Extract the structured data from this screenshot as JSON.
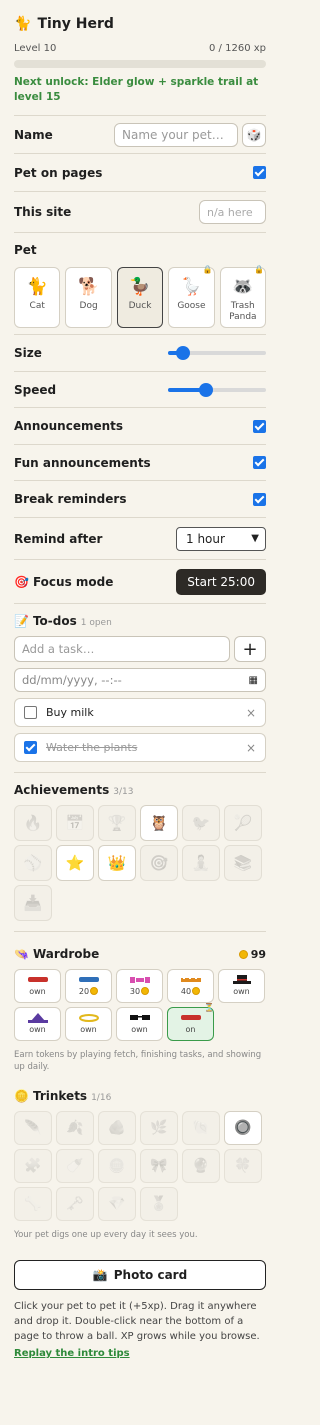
{
  "header": {
    "title_icon": "cat-icon",
    "title": "Tiny Herd",
    "level": "Level 10",
    "xp": "0 / 1260 xp",
    "xp_progress": 0.0,
    "unlock": "Next unlock: Elder glow + sparkle trail at level 15"
  },
  "name": {
    "label": "Name",
    "placeholder": "Name your pet…",
    "dice_icon": "dice-icon"
  },
  "pet_on_pages": {
    "label": "Pet on pages",
    "checked": true
  },
  "this_site": {
    "label": "This site",
    "placeholder": "n/a here"
  },
  "pet": {
    "label": "Pet",
    "options": [
      {
        "name": "Cat",
        "icon": "🐈",
        "selected": false,
        "locked": false
      },
      {
        "name": "Dog",
        "icon": "🐕",
        "selected": false,
        "locked": false
      },
      {
        "name": "Duck",
        "icon": "🦆",
        "selected": true,
        "locked": false
      },
      {
        "name": "Goose",
        "icon": "🪿",
        "selected": false,
        "locked": true
      },
      {
        "name": "Trash Panda",
        "icon": "🦝",
        "selected": false,
        "locked": true
      }
    ],
    "lock_icon": "🔒"
  },
  "size": {
    "label": "Size",
    "value": 0.1
  },
  "speed": {
    "label": "Speed",
    "value": 0.37
  },
  "announcements": {
    "label": "Announcements",
    "checked": true
  },
  "fun_announcements": {
    "label": "Fun announcements",
    "checked": true
  },
  "break_reminders": {
    "label": "Break reminders",
    "checked": true
  },
  "remind_after": {
    "label": "Remind after",
    "value": "1 hour"
  },
  "focus": {
    "icon": "🎯",
    "label": "Focus mode",
    "button": "Start 25:00"
  },
  "todos": {
    "icon": "📝",
    "label": "To-dos",
    "count": "1 open",
    "placeholder": "Add a task…",
    "add": "+",
    "date_placeholder": "dd/mm/yyyy, --:--",
    "items": [
      {
        "text": "Buy milk",
        "done": false
      },
      {
        "text": "Water the plants",
        "done": true
      }
    ],
    "remove": "×"
  },
  "achievements": {
    "label": "Achievements",
    "count": "3/13",
    "items": [
      {
        "icon": "🔥",
        "on": false
      },
      {
        "icon": "📅",
        "on": false
      },
      {
        "icon": "🏆",
        "on": false
      },
      {
        "icon": "🦉",
        "on": true
      },
      {
        "icon": "🐦",
        "on": false
      },
      {
        "icon": "🎾",
        "on": false
      },
      {
        "icon": "⚾",
        "on": false
      },
      {
        "icon": "⭐",
        "on": true
      },
      {
        "icon": "👑",
        "on": true
      },
      {
        "icon": "🎯",
        "on": false
      },
      {
        "icon": "🧘",
        "on": false
      },
      {
        "icon": "📚",
        "on": false
      },
      {
        "icon": "📥",
        "on": false
      }
    ]
  },
  "wardrobe": {
    "icon": "👒",
    "label": "Wardrobe",
    "coins": "99",
    "items": [
      {
        "label": "own",
        "price": "",
        "color": "#c8312b",
        "shape": "cap",
        "on": false
      },
      {
        "label": "",
        "price": "20",
        "color": "#2f6fb8",
        "shape": "cap",
        "on": false
      },
      {
        "label": "",
        "price": "30",
        "color": "#d84fb0",
        "shape": "bow",
        "on": false
      },
      {
        "label": "",
        "price": "40",
        "color": "#e08a1e",
        "shape": "band",
        "on": false
      },
      {
        "label": "own",
        "price": "",
        "color": "#1a1a1a",
        "shape": "tophat",
        "on": false
      },
      {
        "label": "own",
        "price": "",
        "color": "#5a3aa0",
        "shape": "wizard",
        "on": false
      },
      {
        "label": "own",
        "price": "",
        "color": "#e2b81c",
        "shape": "halo",
        "on": false
      },
      {
        "label": "own",
        "price": "",
        "color": "#111111",
        "shape": "shades",
        "on": false
      },
      {
        "label": "on",
        "price": "",
        "color": "#c8312b",
        "shape": "cap",
        "on": true,
        "badge": "⏳"
      }
    ],
    "note": "Earn tokens by playing fetch, finishing tasks, and showing up daily."
  },
  "trinkets": {
    "icon": "🪙",
    "label": "Trinkets",
    "count": "1/16",
    "items": [
      {
        "icon": "🪶",
        "on": false
      },
      {
        "icon": "🍂",
        "on": false
      },
      {
        "icon": "🪨",
        "on": false
      },
      {
        "icon": "🌿",
        "on": false
      },
      {
        "icon": "🐚",
        "on": false
      },
      {
        "icon": "🔘",
        "on": true
      },
      {
        "icon": "🧩",
        "on": false
      },
      {
        "icon": "🍼",
        "on": false
      },
      {
        "icon": "🪙",
        "on": false
      },
      {
        "icon": "🎀",
        "on": false
      },
      {
        "icon": "🔮",
        "on": false
      },
      {
        "icon": "🍀",
        "on": false
      },
      {
        "icon": "🦴",
        "on": false
      },
      {
        "icon": "🗝️",
        "on": false
      },
      {
        "icon": "💎",
        "on": false
      },
      {
        "icon": "🏅",
        "on": false
      }
    ],
    "note": "Your pet digs one up every day it sees you."
  },
  "photo": {
    "icon": "📸",
    "label": "Photo card"
  },
  "help": "Click your pet to pet it (+5xp). Drag it anywhere and drop it. Double-click near the bottom of a page to throw a ball. XP grows while you browse.",
  "replay": "Replay the intro tips"
}
